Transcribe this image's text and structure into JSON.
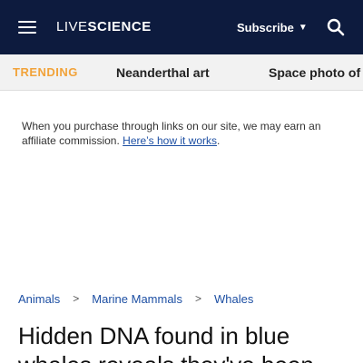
{
  "header": {
    "logo_part1": "LIVE",
    "logo_part2": "SCIENCE",
    "subscribe_label": "Subscribe",
    "subscribe_caret": "▼",
    "bg_color": "#0d1b3e"
  },
  "trending": {
    "label": "TRENDING",
    "items": [
      "Neanderthal art",
      "Space photo of"
    ],
    "label_color": "#f2a33a"
  },
  "affiliate": {
    "text": "When you purchase through links on our site, we may earn an affiliate commission.",
    "link": "Here’s how it works",
    "suffix": "."
  },
  "breadcrumb": {
    "items": [
      "Animals",
      "Marine Mammals",
      "Whales"
    ],
    "separator": ">"
  },
  "article": {
    "headline": "Hidden DNA found in blue whales reveals they've been"
  }
}
